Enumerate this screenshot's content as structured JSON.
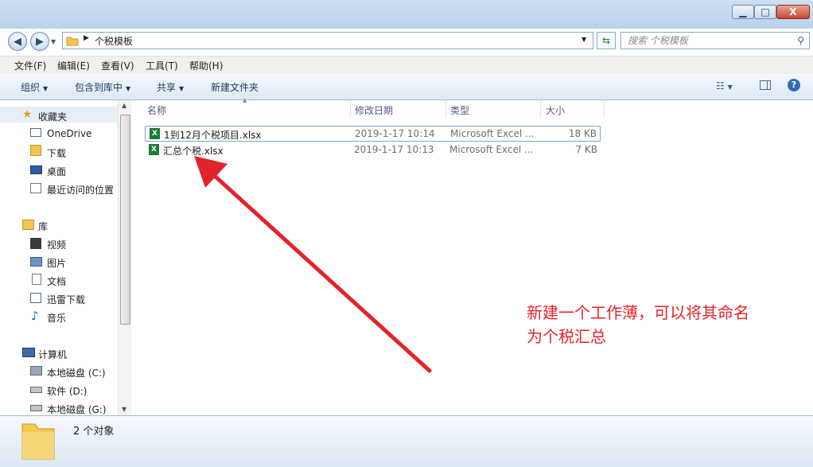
{
  "window": {
    "min": "▁",
    "max": "□",
    "close": "X"
  },
  "address": {
    "path": "个税模板",
    "back": "◀",
    "forward": "▶"
  },
  "search": {
    "placeholder": "搜索 个税模板"
  },
  "menu": [
    "文件(F)",
    "编辑(E)",
    "查看(V)",
    "工具(T)",
    "帮助(H)"
  ],
  "toolbar": {
    "organize": "组织",
    "include": "包含到库中",
    "share": "共享",
    "new_folder": "新建文件夹"
  },
  "nav": {
    "favorites": "收藏夹",
    "favorites_items": [
      "OneDrive",
      "下载",
      "桌面",
      "最近访问的位置"
    ],
    "libraries": "库",
    "library_items": [
      "视频",
      "图片",
      "文档",
      "迅雷下载",
      "音乐"
    ],
    "computer": "计算机",
    "computer_items": [
      "本地磁盘 (C:)",
      "软件 (D:)",
      "本地磁盘 (G:)"
    ]
  },
  "columns": {
    "name": "名称",
    "modified": "修改日期",
    "type": "类型",
    "size": "大小"
  },
  "files": [
    {
      "name": "1到12月个税项目.xlsx",
      "modified": "2019-1-17 10:14",
      "type": "Microsoft Excel ...",
      "size": "18 KB"
    },
    {
      "name": "汇总个税.xlsx",
      "modified": "2019-1-17 10:13",
      "type": "Microsoft Excel ...",
      "size": "7 KB"
    }
  ],
  "status": {
    "count": "2 个对象"
  },
  "annotation": {
    "line1": "新建一个工作薄，可以将其命名",
    "line2": "为个税汇总"
  },
  "colors": {
    "accent": "#e3232a",
    "chrome": "#b9d1ea"
  },
  "icons": [
    "folder-icon",
    "excel-icon",
    "star-icon",
    "computer-icon",
    "help-icon"
  ]
}
